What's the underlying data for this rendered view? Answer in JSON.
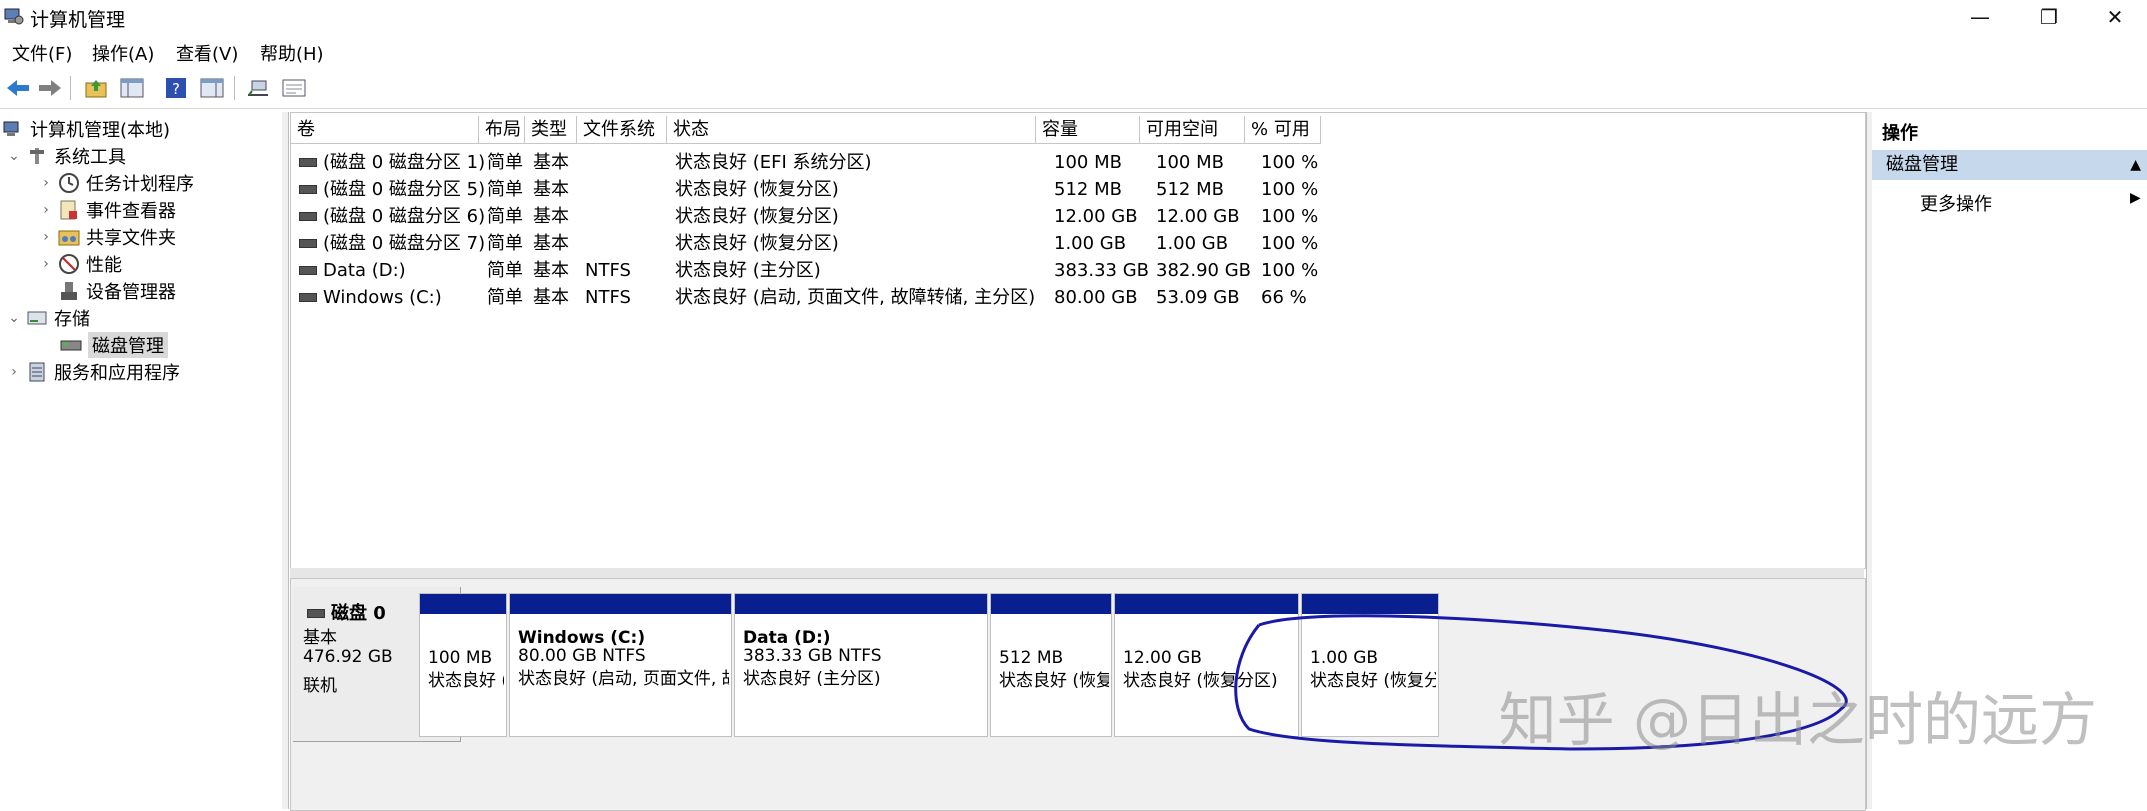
{
  "window": {
    "title": "计算机管理",
    "minimize_glyph": "—",
    "restore_glyph": "❐",
    "close_glyph": "✕"
  },
  "menu": [
    "文件(F)",
    "操作(A)",
    "查看(V)",
    "帮助(H)"
  ],
  "toolbar": [
    "back-icon",
    "forward-icon",
    "up-folder-icon",
    "show-hide-tree-icon",
    "help-icon",
    "properties-icon",
    "connect-icon",
    "console-icon"
  ],
  "tree": {
    "root": "计算机管理(本地)",
    "system_tools": "系统工具",
    "task_scheduler": "任务计划程序",
    "event_viewer": "事件查看器",
    "shared_folders": "共享文件夹",
    "performance": "性能",
    "device_manager": "设备管理器",
    "storage": "存储",
    "disk_management": "磁盘管理",
    "services_apps": "服务和应用程序"
  },
  "columns": [
    "卷",
    "布局",
    "类型",
    "文件系统",
    "状态",
    "容量",
    "可用空间",
    "% 可用"
  ],
  "volumes": [
    {
      "name": "(磁盘 0 磁盘分区 1)",
      "layout": "简单",
      "type": "基本",
      "fs": "",
      "status": "状态良好 (EFI 系统分区)",
      "capacity": "100 MB",
      "free": "100 MB",
      "pct": "100 %"
    },
    {
      "name": "(磁盘 0 磁盘分区 5)",
      "layout": "简单",
      "type": "基本",
      "fs": "",
      "status": "状态良好 (恢复分区)",
      "capacity": "512 MB",
      "free": "512 MB",
      "pct": "100 %"
    },
    {
      "name": "(磁盘 0 磁盘分区 6)",
      "layout": "简单",
      "type": "基本",
      "fs": "",
      "status": "状态良好 (恢复分区)",
      "capacity": "12.00 GB",
      "free": "12.00 GB",
      "pct": "100 %"
    },
    {
      "name": "(磁盘 0 磁盘分区 7)",
      "layout": "简单",
      "type": "基本",
      "fs": "",
      "status": "状态良好 (恢复分区)",
      "capacity": "1.00 GB",
      "free": "1.00 GB",
      "pct": "100 %"
    },
    {
      "name": "Data (D:)",
      "layout": "简单",
      "type": "基本",
      "fs": "NTFS",
      "status": "状态良好 (主分区)",
      "capacity": "383.33 GB",
      "free": "382.90 GB",
      "pct": "100 %"
    },
    {
      "name": "Windows (C:)",
      "layout": "简单",
      "type": "基本",
      "fs": "NTFS",
      "status": "状态良好 (启动, 页面文件, 故障转储, 主分区)",
      "capacity": "80.00 GB",
      "free": "53.09 GB",
      "pct": "66 %"
    }
  ],
  "disk": {
    "name": "磁盘 0",
    "type": "基本",
    "size": "476.92 GB",
    "state": "联机"
  },
  "partitions": [
    {
      "title": "",
      "line1": "100 MB",
      "line2": "状态良好 (EF"
    },
    {
      "title": "Windows  (C:)",
      "line1": "80.00 GB NTFS",
      "line2": "状态良好 (启动, 页面文件, 故障转储,"
    },
    {
      "title": "Data  (D:)",
      "line1": "383.33 GB NTFS",
      "line2": "状态良好 (主分区)"
    },
    {
      "title": "",
      "line1": "512 MB",
      "line2": "状态良好 (恢复分▯"
    },
    {
      "title": "",
      "line1": "12.00 GB",
      "line2": "状态良好 (恢复分区)"
    },
    {
      "title": "",
      "line1": "1.00 GB",
      "line2": "状态良好 (恢复分区)"
    }
  ],
  "actions": {
    "header": "操作",
    "section": "磁盘管理",
    "more": "更多操作"
  },
  "watermark": "知乎 @日出之时的远方",
  "colors": {
    "partition_band": "#0a1f8f",
    "selection": "#d9d9d9",
    "action_section": "#c6d8ec",
    "annotation": "#1a1aa8"
  }
}
